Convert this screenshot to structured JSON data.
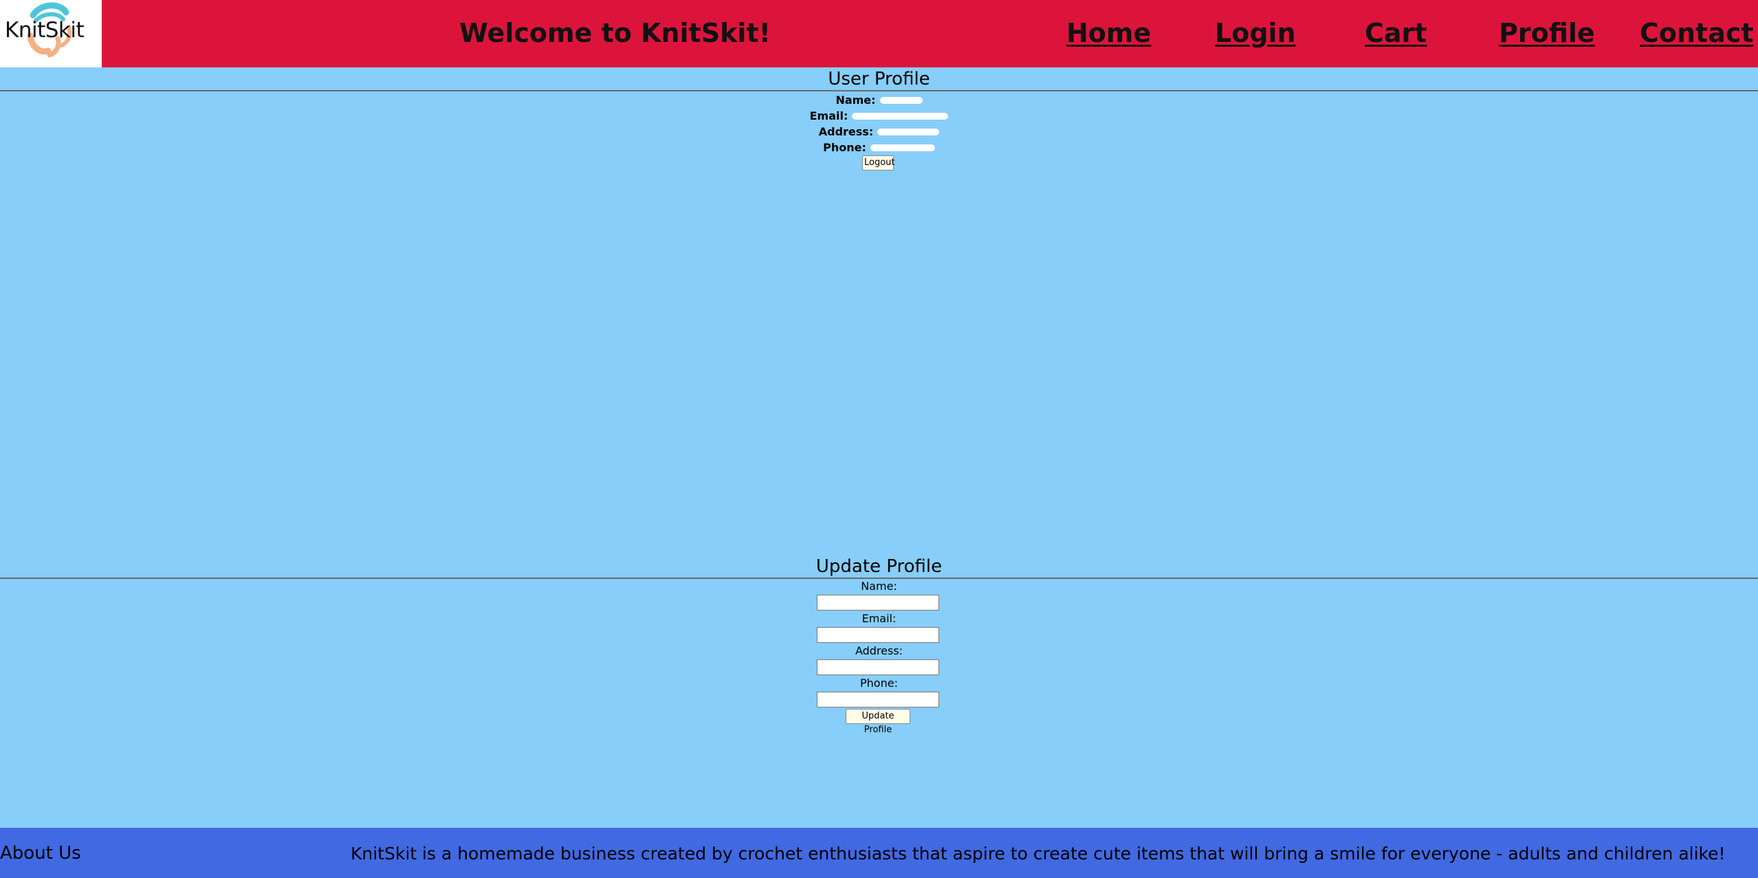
{
  "header": {
    "logo_text": "KnitSkit",
    "title": "Welcome to KnitSkit!",
    "nav": [
      {
        "label": "Home"
      },
      {
        "label": "Login"
      },
      {
        "label": "Cart"
      },
      {
        "label": "Profile"
      },
      {
        "label": "Contact"
      }
    ]
  },
  "profile": {
    "title": "User Profile",
    "fields": [
      {
        "label": "Name:"
      },
      {
        "label": "Email:"
      },
      {
        "label": "Address:"
      },
      {
        "label": "Phone:"
      }
    ],
    "logout_label": "Logout"
  },
  "update": {
    "title": "Update Profile",
    "fields": [
      {
        "label": "Name:",
        "value": ""
      },
      {
        "label": "Email:",
        "value": ""
      },
      {
        "label": "Address:",
        "value": ""
      },
      {
        "label": "Phone:",
        "value": ""
      }
    ],
    "submit_label": "Update Profile"
  },
  "footer": {
    "heading": "About Us",
    "text": "KnitSkit is a homemade business created by crochet enthusiasts that aspire to create cute items that will bring a smile for everyone - adults and children alike!"
  },
  "colors": {
    "header_bg": "#dc143c",
    "page_bg": "#87cefa",
    "footer_bg": "#4169e1"
  }
}
